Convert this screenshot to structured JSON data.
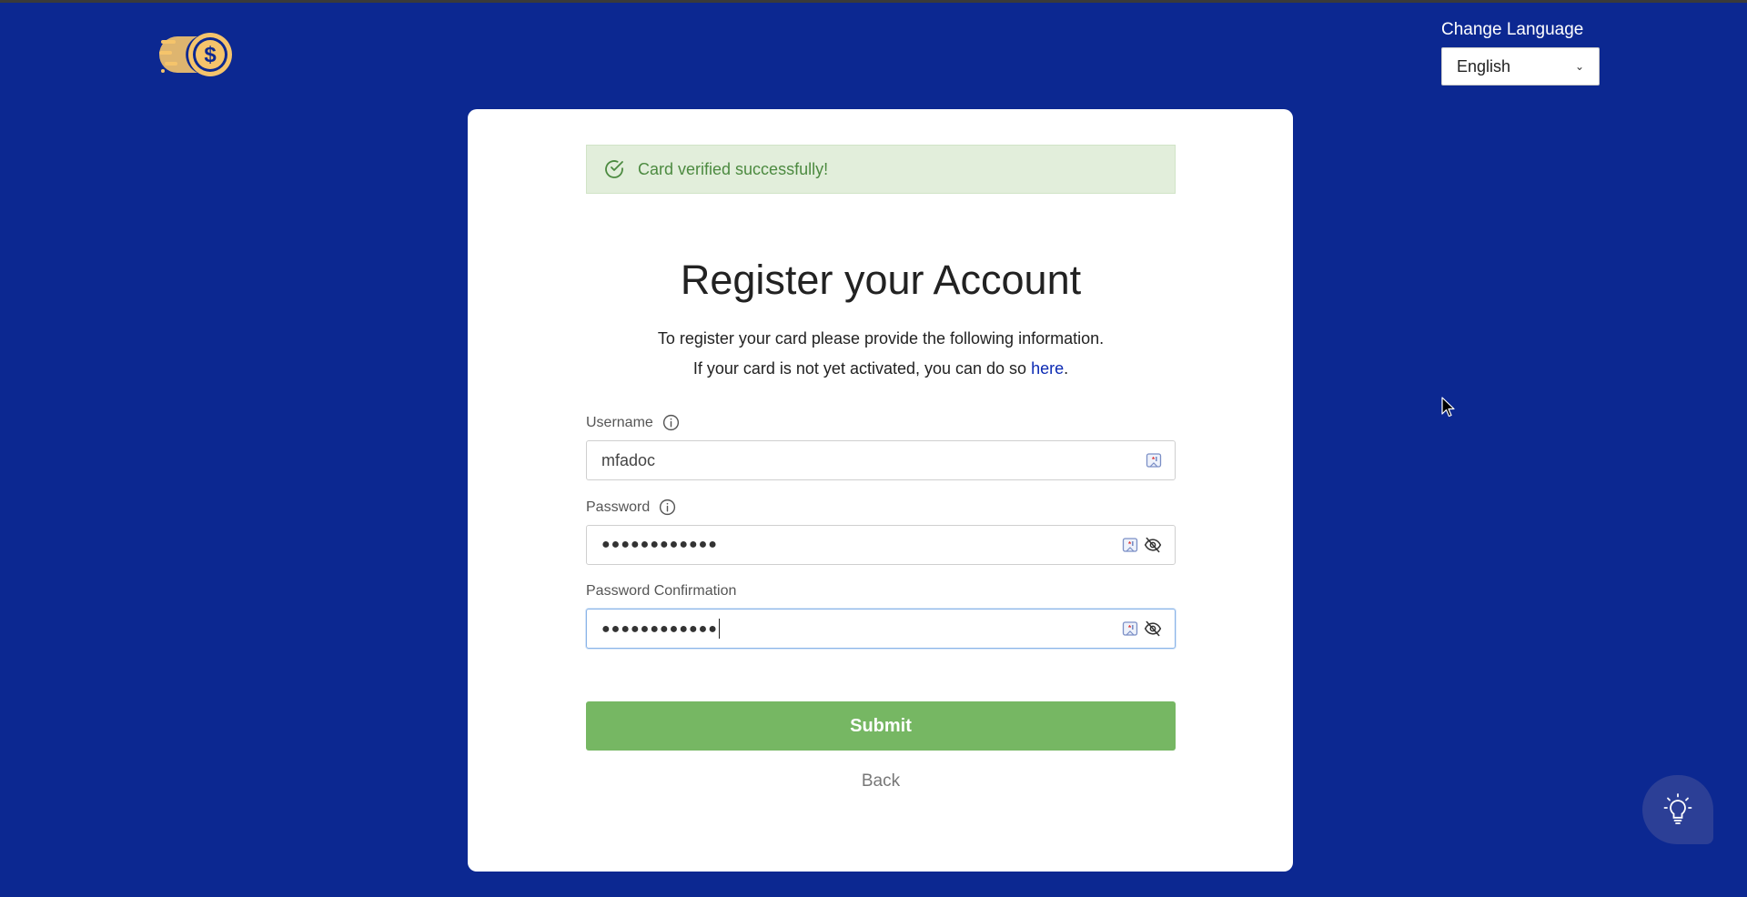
{
  "language": {
    "label": "Change Language",
    "selected": "English"
  },
  "alert": {
    "message": "Card verified successfully!"
  },
  "form": {
    "title": "Register your Account",
    "description_line1": "To register your card please provide the following information.",
    "description_line2_prefix": "If your card is not yet activated, you can do so ",
    "description_link": "here",
    "description_line2_suffix": ".",
    "username_label": "Username",
    "username_value": "mfadoc",
    "password_label": "Password",
    "password_value": "●●●●●●●●●●●●",
    "password_confirm_label": "Password Confirmation",
    "password_confirm_value": "●●●●●●●●●●●●",
    "submit_label": "Submit",
    "back_label": "Back"
  },
  "colors": {
    "background": "#0c2891",
    "success_bg": "#e2eedb",
    "success_text": "#4c8a40",
    "submit_bg": "#76b763",
    "logo": "#f5c46b"
  },
  "icons": [
    "logo-icon",
    "check-circle-icon",
    "info-icon",
    "password-manager-icon",
    "eye-off-icon",
    "chevron-down-icon",
    "lightbulb-icon",
    "mouse-cursor-icon"
  ]
}
